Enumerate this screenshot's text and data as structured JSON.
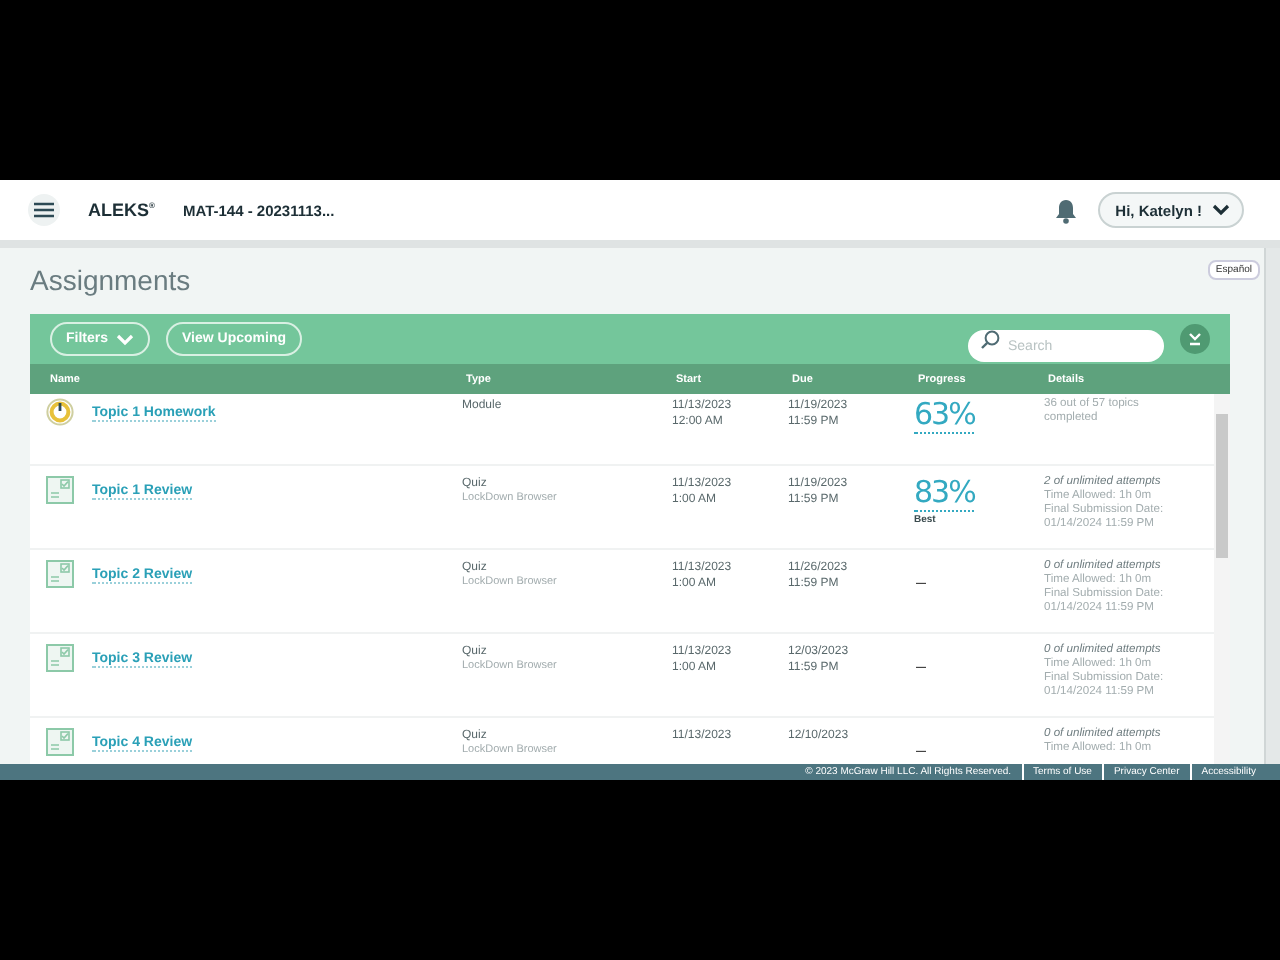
{
  "header": {
    "logo": "ALEKS",
    "logo_mark": "®",
    "course": "MAT-144 - 20231113...",
    "user_menu": "Hi, Katelyn !"
  },
  "page": {
    "title": "Assignments",
    "language_link": "Español"
  },
  "toolbar": {
    "filters": "Filters",
    "view_upcoming": "View Upcoming",
    "search": {
      "placeholder": "Search"
    }
  },
  "table": {
    "columns": [
      "Name",
      "Type",
      "Start",
      "Due",
      "Progress",
      "Details"
    ],
    "rows": [
      {
        "kind": "module",
        "name": "Topic 1 Homework",
        "type": "Module",
        "start": [
          "11/13/2023",
          "12:00 AM"
        ],
        "due": [
          "11/19/2023",
          "11:59 PM"
        ],
        "progress": {
          "value": "63%"
        },
        "details": [
          "36 out of 57 topics completed"
        ]
      },
      {
        "kind": "quiz",
        "name": "Topic 1 Review",
        "type": "Quiz",
        "type_note": "LockDown Browser",
        "start": [
          "11/13/2023",
          "1:00 AM"
        ],
        "due": [
          "11/19/2023",
          "11:59 PM"
        ],
        "progress": {
          "value": "83%",
          "note": "Best"
        },
        "details": [
          "2 of unlimited attempts",
          "Time Allowed: 1h 0m",
          "Final Submission Date: 01/14/2024 11:59 PM"
        ]
      },
      {
        "kind": "quiz",
        "name": "Topic 2 Review",
        "type": "Quiz",
        "type_note": "LockDown Browser",
        "start": [
          "11/13/2023",
          "1:00 AM"
        ],
        "due": [
          "11/26/2023",
          "11:59 PM"
        ],
        "progress": {
          "value": "–"
        },
        "details": [
          "0 of unlimited attempts",
          "Time Allowed: 1h 0m",
          "Final Submission Date: 01/14/2024 11:59 PM"
        ]
      },
      {
        "kind": "quiz",
        "name": "Topic 3 Review",
        "type": "Quiz",
        "type_note": "LockDown Browser",
        "start": [
          "11/13/2023",
          "1:00 AM"
        ],
        "due": [
          "12/03/2023",
          "11:59 PM"
        ],
        "progress": {
          "value": "–"
        },
        "details": [
          "0 of unlimited attempts",
          "Time Allowed: 1h 0m",
          "Final Submission Date: 01/14/2024 11:59 PM"
        ]
      },
      {
        "kind": "quiz",
        "name": "Topic 4 Review",
        "type": "Quiz",
        "type_note": "LockDown Browser",
        "start": [
          "11/13/2023"
        ],
        "due": [
          "12/10/2023"
        ],
        "progress": {
          "value": "–"
        },
        "details": [
          "0 of unlimited attempts",
          "Time Allowed: 1h 0m"
        ]
      }
    ]
  },
  "footer": {
    "copyright": "© 2023 McGraw Hill LLC. All Rights Reserved.",
    "links": [
      "Terms of Use",
      "Privacy Center",
      "Accessibility"
    ]
  }
}
